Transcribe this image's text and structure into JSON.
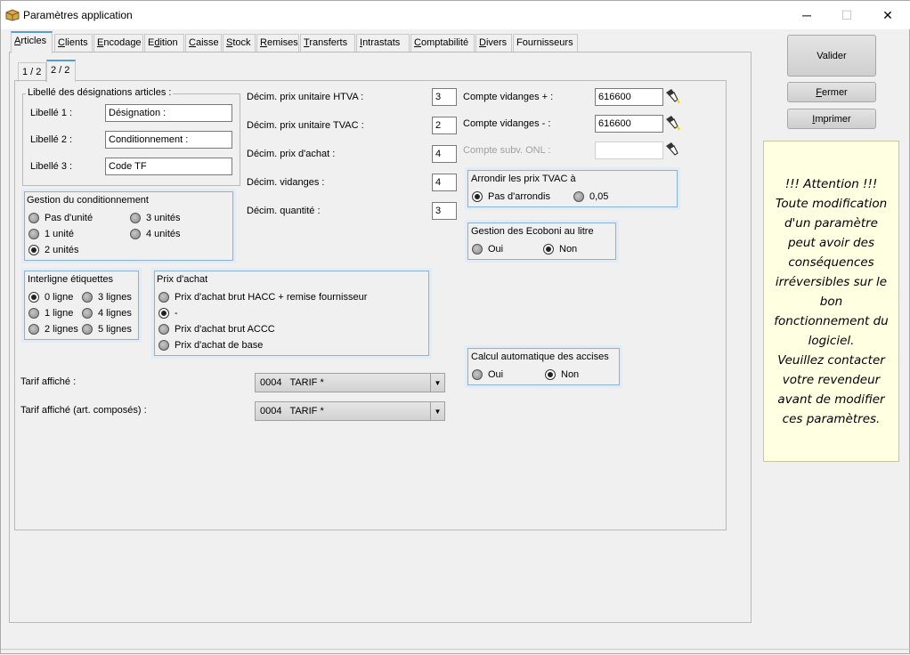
{
  "window": {
    "title": "Paramètres application",
    "minimize": "─",
    "maximize": "☐",
    "close": "✕"
  },
  "tabs": [
    {
      "pre": "",
      "u": "A",
      "post": "rticles"
    },
    {
      "pre": "",
      "u": "C",
      "post": "lients"
    },
    {
      "pre": "",
      "u": "E",
      "post": "ncodage"
    },
    {
      "pre": "E",
      "u": "d",
      "post": "ition"
    },
    {
      "pre": "",
      "u": "C",
      "post": "aisse"
    },
    {
      "pre": "",
      "u": "S",
      "post": "tock"
    },
    {
      "pre": "",
      "u": "R",
      "post": "emises"
    },
    {
      "pre": "",
      "u": "T",
      "post": "ransferts"
    },
    {
      "pre": "",
      "u": "I",
      "post": "ntrastats"
    },
    {
      "pre": "",
      "u": "C",
      "post": "omptabilité"
    },
    {
      "pre": "",
      "u": "D",
      "post": "ivers"
    },
    {
      "pre": "Fournisseurs",
      "u": "",
      "post": ""
    }
  ],
  "subtabs": [
    "1 / 2",
    "2 / 2"
  ],
  "libelles": {
    "title": "Libellé des désignations articles :",
    "l1": "Libellé 1 :",
    "v1": "Désignation :",
    "l2": "Libellé 2 :",
    "v2": "Conditionnement :",
    "l3": "Libellé 3 :",
    "v3": "Code TF"
  },
  "conditionnement": {
    "title": "Gestion du conditionnement",
    "o1": "Pas d'unité",
    "o2": "1 unité",
    "o3": "2 unités",
    "o4": "3 unités",
    "o5": "4 unités",
    "selected": "2 unités"
  },
  "interligne": {
    "title": "Interligne étiquettes",
    "o1": "0 ligne",
    "o2": "1 ligne",
    "o3": "2 lignes",
    "o4": "3 lignes",
    "o5": "4 lignes",
    "o6": "5 lignes",
    "selected": "0 ligne"
  },
  "prix_achat": {
    "title": "Prix d'achat",
    "o1": "Prix d'achat brut HACC + remise fournisseur",
    "o2": "-",
    "o3": "Prix d'achat brut ACCC",
    "o4": "Prix d'achat de base",
    "selected": "-"
  },
  "decimales": {
    "htva_label": "Décim. prix unitaire HTVA :",
    "htva": "3",
    "tvac_label": "Décim. prix unitaire TVAC :",
    "tvac": "2",
    "achat_label": "Décim. prix d'achat :",
    "achat": "4",
    "vidanges_label": "Décim. vidanges :",
    "vidanges": "4",
    "quantite_label": "Décim. quantité :",
    "quantite": "3"
  },
  "comptes": {
    "plus_label": "Compte vidanges + :",
    "plus": "616600",
    "moins_label": "Compte vidanges - :",
    "moins": "616600",
    "onl_label": "Compte subv. ONL :",
    "onl": ""
  },
  "arrondir": {
    "title": "Arrondir les prix TVAC à",
    "o1": "Pas d'arrondis",
    "o2": "0,05",
    "selected": "Pas d'arrondis"
  },
  "ecoboni": {
    "title": "Gestion des Ecoboni au litre",
    "o1": "Oui",
    "o2": "Non",
    "selected": "Non"
  },
  "accises": {
    "title": "Calcul automatique des accises",
    "o1": "Oui",
    "o2": "Non",
    "selected": "Non"
  },
  "tarif": {
    "label": "Tarif affiché :",
    "value": "0004   TARIF *",
    "label2": "Tarif affiché (art. composés) :",
    "value2": "0004   TARIF *"
  },
  "buttons": {
    "valider": "Valider",
    "fermer": {
      "u": "F",
      "post": "ermer"
    },
    "imprimer": {
      "u": "I",
      "post": "mprimer"
    }
  },
  "warning": {
    "lines": [
      "!!! Attention !!!",
      "Toute modification",
      "d'un paramètre",
      "peut avoir des",
      "conséquences",
      "irréversibles sur le",
      "bon",
      "fonctionnement du",
      "logiciel.",
      "Veuillez contacter",
      "votre revendeur",
      "avant de modifier",
      "ces paramètres."
    ]
  }
}
